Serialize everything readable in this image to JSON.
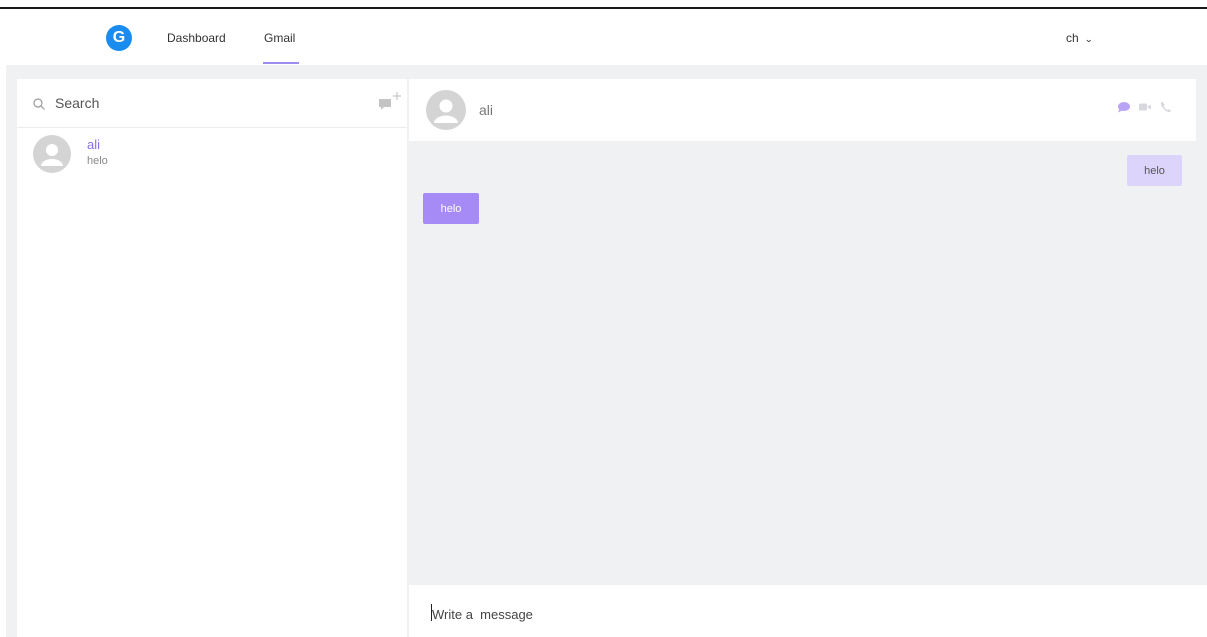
{
  "nav": {
    "logo_letter": "G",
    "links": [
      {
        "label": "Dashboard"
      },
      {
        "label": "Gmail",
        "active": true
      }
    ],
    "user": {
      "label": "ch",
      "chevron": "⌄"
    }
  },
  "sidebar": {
    "search": {
      "placeholder": "Search",
      "value": ""
    },
    "compose_icon": "new-chat-icon",
    "contacts": [
      {
        "name": "ali",
        "last_message": "helo",
        "avatar": "user-avatar-icon"
      }
    ]
  },
  "chat": {
    "header": {
      "name": "ali",
      "icons": [
        "message-icon",
        "video-icon",
        "phone-icon"
      ]
    },
    "messages": [
      {
        "text": "helo",
        "direction": "outgoing"
      },
      {
        "text": "helo",
        "direction": "incoming"
      }
    ],
    "composer": {
      "placeholder": "Write a  message",
      "value": ""
    }
  },
  "colors": {
    "accent": "#a68af5",
    "accent_light": "#ddd4fb",
    "logo_blue": "#1a8cf0",
    "app_background": "#f0f1f3"
  }
}
